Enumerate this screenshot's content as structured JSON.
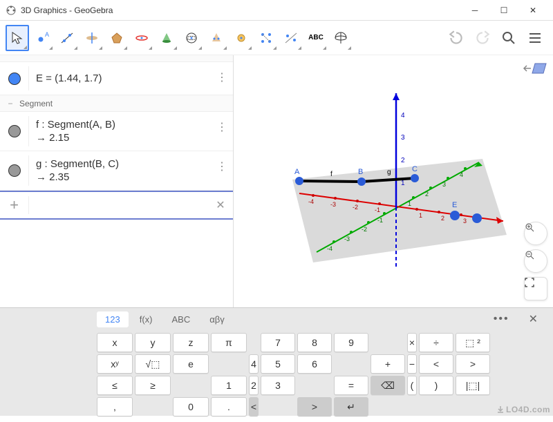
{
  "window": {
    "title": "3D Graphics - GeoGebra"
  },
  "toolbar_tools": [
    "move",
    "point",
    "line",
    "plane",
    "polygon",
    "circle",
    "cone",
    "sphere",
    "intersect",
    "tangent",
    "angle",
    "reflect",
    "text",
    "rotate-view"
  ],
  "algebra": {
    "point": {
      "label": "E = (1.44, 1.7)"
    },
    "section": "Segment",
    "seg_f": {
      "def": "f : Segment(A, B)",
      "val": "→   2.15"
    },
    "seg_g": {
      "def": "g : Segment(B, C)",
      "val": "→   2.35"
    }
  },
  "graphics": {
    "points": {
      "A": "A",
      "B": "B",
      "C": "C",
      "E": "E"
    },
    "segments": {
      "f": "f",
      "g": "g"
    },
    "axis_ticks_z": [
      "1",
      "2",
      "3",
      "4"
    ],
    "axis_ticks_x": [
      "-4",
      "-3",
      "-2",
      "-1",
      "1",
      "2",
      "3"
    ],
    "axis_ticks_y": [
      "-4",
      "-3",
      "-2",
      "-1",
      "1",
      "2",
      "3",
      "4"
    ]
  },
  "keyboard": {
    "tabs": {
      "num": "123",
      "fx": "f(x)",
      "abc": "ABC",
      "greek": "αβγ"
    },
    "keys": {
      "r1": [
        "x",
        "y",
        "z",
        "π",
        "7",
        "8",
        "9",
        "×",
        "÷"
      ],
      "r2": [
        "⬚ ²",
        "xʸ",
        "√⬚",
        "e",
        "4",
        "5",
        "6",
        "+",
        "−"
      ],
      "r3": [
        "<",
        ">",
        "≤",
        "≥",
        "1",
        "2",
        "3",
        "=",
        "⌫"
      ],
      "r4": [
        "(",
        ")",
        "|⬚|",
        ",",
        "0",
        ".",
        "<",
        ">",
        "↵"
      ]
    }
  },
  "watermark": "LO4D.com"
}
